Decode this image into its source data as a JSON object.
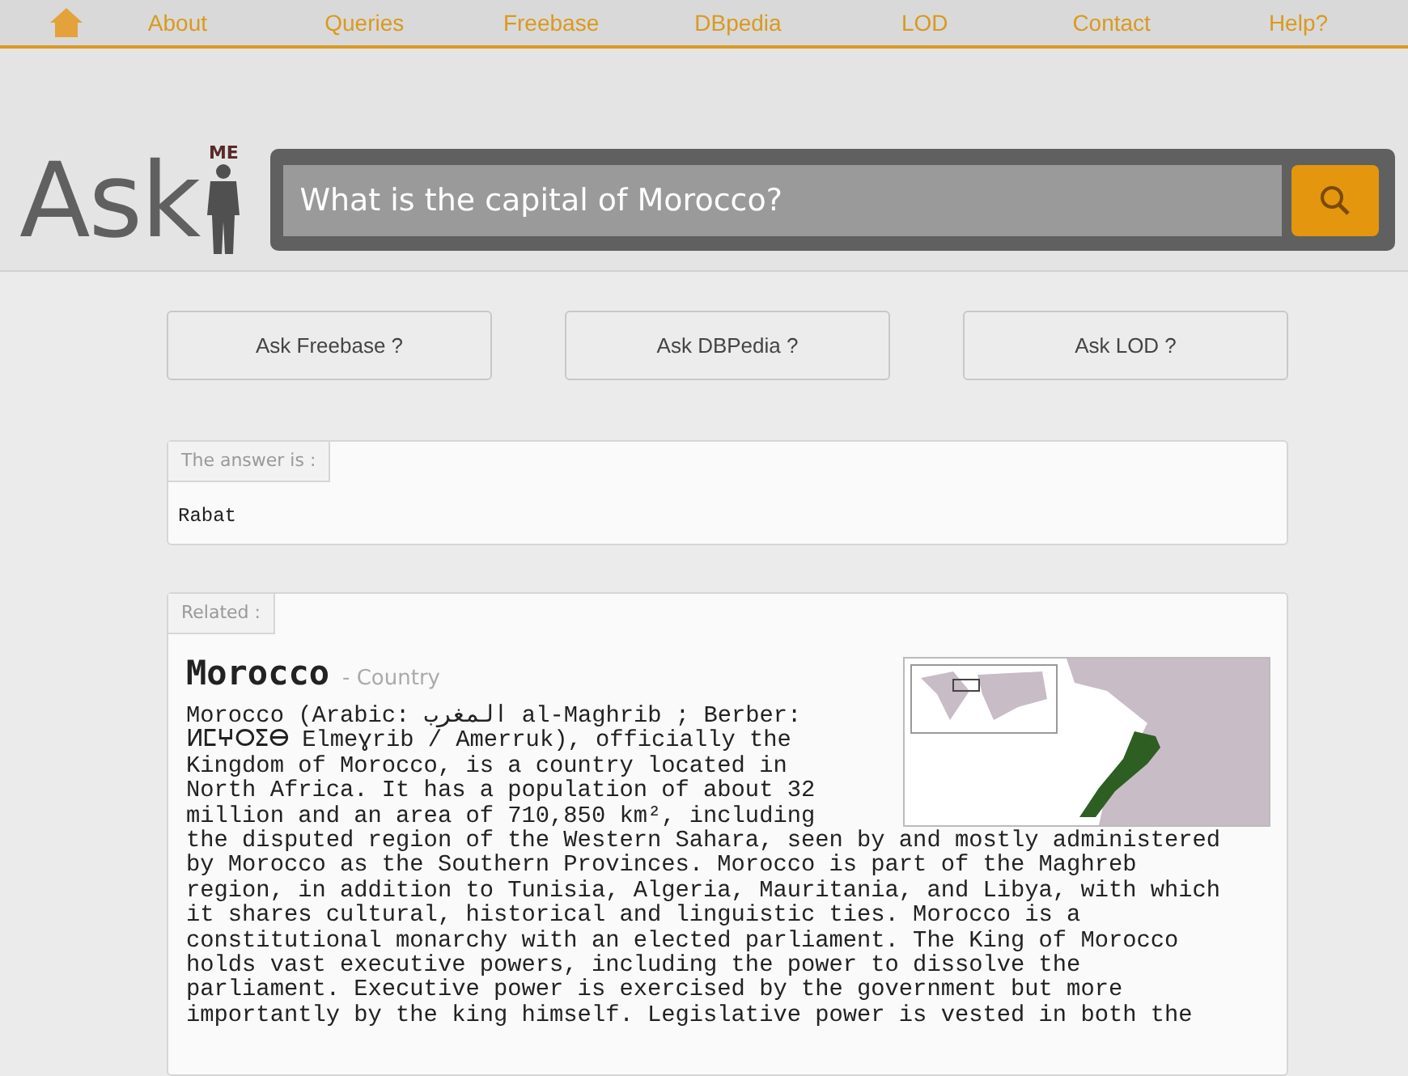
{
  "nav": {
    "items": [
      "About",
      "Queries",
      "Freebase",
      "DBpedia",
      "LOD",
      "Contact",
      "Help?"
    ]
  },
  "logo": {
    "word": "Ask",
    "badge": "ME"
  },
  "search": {
    "value": "What is the capital of Morocco?"
  },
  "ask_buttons": [
    "Ask Freebase ?",
    "Ask DBPedia ?",
    "Ask LOD ?"
  ],
  "answer": {
    "label": "The answer is :",
    "value": "Rabat"
  },
  "related": {
    "label": "Related :",
    "title": "Morocco",
    "subtitle": "- Country",
    "text_lead": "Morocco (Arabic: المغرب al-Maghrib ; Berber: ⵍⵎⵖⵔⵉⴱ Elmeɣrib / Amerruk), officially the Kingdom of Morocco, is a country located in North Africa. It has a population of about 32 million and an area of 710,850 km², including",
    "text": "the disputed region of the Western Sahara, seen by and mostly administered by Morocco as the Southern Provinces. Morocco is part of the Maghreb region, in addition to Tunisia, Algeria, Mauritania, and Libya, with which it shares cultural, historical and linguistic ties. Morocco is a constitutional monarchy with an elected parliament. The King of Morocco holds vast executive powers, including the power to dissolve the parliament. Executive power is exercised by the government but more importantly by the king himself. Legislative power is vested in both the"
  }
}
